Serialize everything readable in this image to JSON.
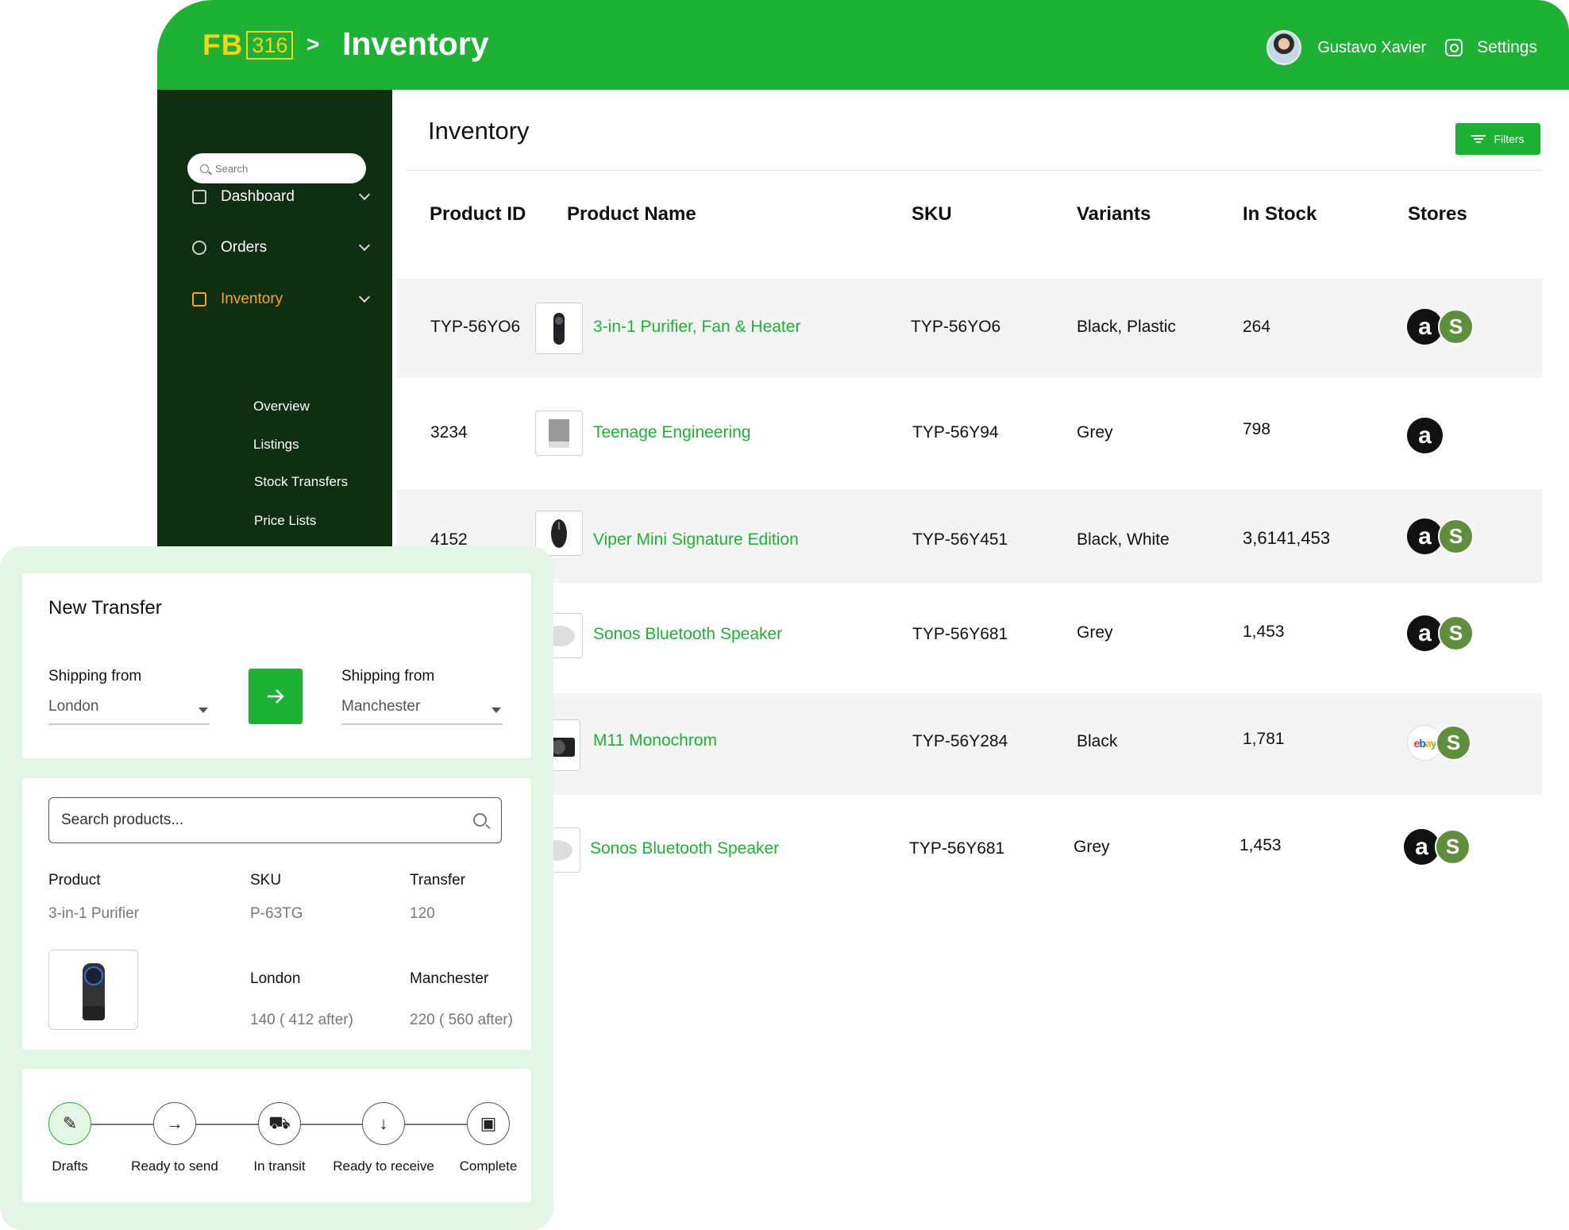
{
  "header": {
    "logo_text": "FB",
    "logo_number": "316",
    "breadcrumb_separator": ">",
    "page_title": "Inventory",
    "user_name": "Gustavo Xavier",
    "settings_label": "Settings"
  },
  "sidebar": {
    "search_placeholder": "Search",
    "items": [
      {
        "label": "Dashboard",
        "icon": "dashboard-icon"
      },
      {
        "label": "Orders",
        "icon": "orders-icon"
      },
      {
        "label": "Inventory",
        "icon": "inventory-icon",
        "active": true
      }
    ],
    "sub_items": [
      "Overview",
      "Listings",
      "Stock Transfers",
      "Price Lists"
    ]
  },
  "main": {
    "title": "Inventory",
    "filters_label": "Filters",
    "columns": [
      "Product ID",
      "Product Name",
      "SKU",
      "Variants",
      "In Stock",
      "Stores"
    ],
    "rows": [
      {
        "id": "TYP-56YO6",
        "name": "3-in-1 Purifier, Fan & Heater",
        "sku": "TYP-56YO6",
        "variants": "Black, Plastic",
        "stock": "264",
        "stores": [
          "amazon",
          "shopify"
        ]
      },
      {
        "id": "3234",
        "name": "Teenage Engineering",
        "sku": "TYP-56Y94",
        "variants": "Grey",
        "stock": "798",
        "stores": [
          "amazon"
        ]
      },
      {
        "id": "4152",
        "name": "Viper Mini Signature Edition",
        "sku": "TYP-56Y451",
        "variants": "Black, White",
        "stock": "3,6141,453",
        "stores": [
          "amazon",
          "shopify"
        ]
      },
      {
        "id": "",
        "name": "Sonos Bluetooth Speaker",
        "sku": "TYP-56Y681",
        "variants": "Grey",
        "stock": "1,453",
        "stores": [
          "amazon",
          "shopify"
        ]
      },
      {
        "id": "",
        "name": "M11 Monochrom",
        "sku": "TYP-56Y284",
        "variants": "Black",
        "stock": "1,781",
        "stores": [
          "ebay",
          "shopify"
        ]
      },
      {
        "id": "",
        "name": "Sonos Bluetooth Speaker",
        "sku": "TYP-56Y681",
        "variants": "Grey",
        "stock": "1,453",
        "stores": [
          "amazon",
          "shopify"
        ]
      }
    ],
    "store_glyphs": {
      "amazon": "a",
      "shopify": "S",
      "ebay": [
        "e",
        "b",
        "a",
        "y"
      ]
    }
  },
  "transfer": {
    "title": "New Transfer",
    "from_label": "Shipping from",
    "from_value": "London",
    "to_label": "Shipping from",
    "to_value": "Manchester",
    "search_placeholder": "Search products...",
    "product_col": "Product",
    "sku_col": "SKU",
    "transfer_col": "Transfer",
    "product_value": "3-in-1 Purifier",
    "sku_value": "P-63TG",
    "transfer_value": "120",
    "loc1_label": "London",
    "loc2_label": "Manchester",
    "loc1_value": "140 ( 412 after)",
    "loc2_value": "220 ( 560 after)"
  },
  "steps": [
    {
      "label": "Drafts",
      "glyph": "✎"
    },
    {
      "label": "Ready to send",
      "glyph": "→"
    },
    {
      "label": "In transit",
      "glyph": "⛟"
    },
    {
      "label": "Ready to receive",
      "glyph": "↓"
    },
    {
      "label": "Complete",
      "glyph": "▣"
    }
  ],
  "colors": {
    "brand": "#1fb036",
    "sidebar": "#102f10",
    "logo": "#f5d316",
    "active_nav": "#f5a623"
  }
}
